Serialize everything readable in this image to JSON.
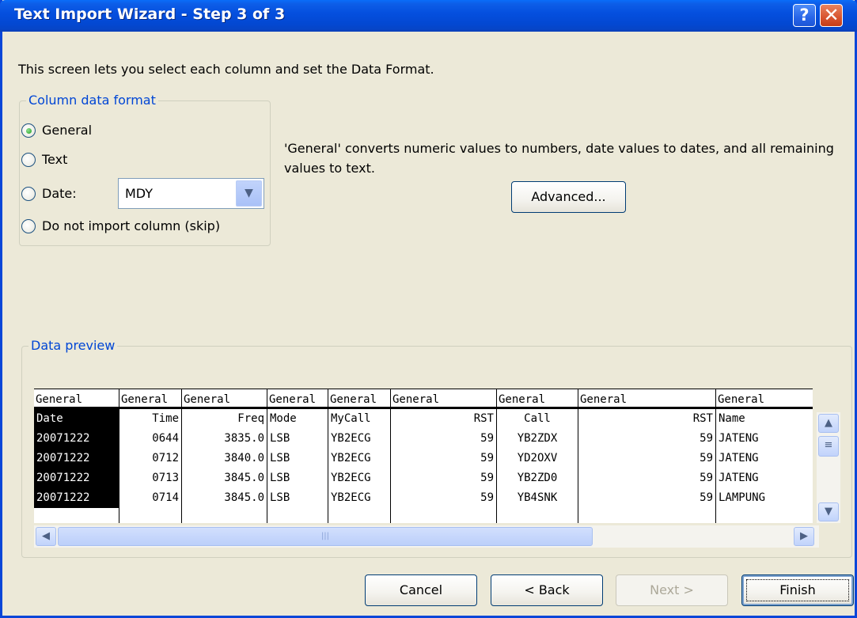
{
  "window": {
    "title": "Text Import Wizard - Step 3 of 3",
    "help_glyph": "?",
    "close_glyph": "✕"
  },
  "description": "This screen lets you select each column and set the Data Format.",
  "format_group": {
    "label": "Column data format",
    "options": [
      "General",
      "Text",
      "Date:",
      "Do not import column (skip)"
    ],
    "selected": "General",
    "date_order": "MDY"
  },
  "explanation": "'General' converts numeric values to numbers, date values to dates, and all remaining values to text.",
  "advanced_label": "Advanced...",
  "preview": {
    "label": "Data preview",
    "columns": [
      {
        "format": "General",
        "header": "Date",
        "cells": [
          "20071222",
          "20071222",
          "20071222",
          "20071222"
        ]
      },
      {
        "format": "General",
        "header": "Time",
        "cells": [
          "0644",
          "0712",
          "0713",
          "0714"
        ]
      },
      {
        "format": "General",
        "header": "Freq",
        "cells": [
          "3835.0",
          "3840.0",
          "3845.0",
          "3845.0"
        ]
      },
      {
        "format": "General",
        "header": "Mode",
        "cells": [
          "LSB",
          "LSB",
          "LSB",
          "LSB"
        ]
      },
      {
        "format": "General",
        "header": "MyCall",
        "cells": [
          "YB2ECG",
          "YB2ECG",
          "YB2ECG",
          "YB2ECG"
        ]
      },
      {
        "format": "General",
        "header": "RST",
        "cells": [
          "59",
          "59",
          "59",
          "59"
        ]
      },
      {
        "format": "General",
        "header": "Call",
        "cells": [
          "YB2ZDX",
          "YD2OXV",
          "YB2ZD0",
          "YB4SNK"
        ]
      },
      {
        "format": "General",
        "header": "RST",
        "cells": [
          "59",
          "59",
          "59",
          "59"
        ]
      },
      {
        "format": "General",
        "header": "Name",
        "cells": [
          "JATENG",
          "JATENG",
          "JATENG",
          "LAMPUNG"
        ]
      }
    ]
  },
  "buttons": {
    "cancel": "Cancel",
    "back": "< Back",
    "next": "Next >",
    "finish": "Finish"
  },
  "colors": {
    "title_bar": "#0550df",
    "dialog_bg": "#ece9d8",
    "group_label": "#0046d5",
    "selected_column": "#000000"
  }
}
